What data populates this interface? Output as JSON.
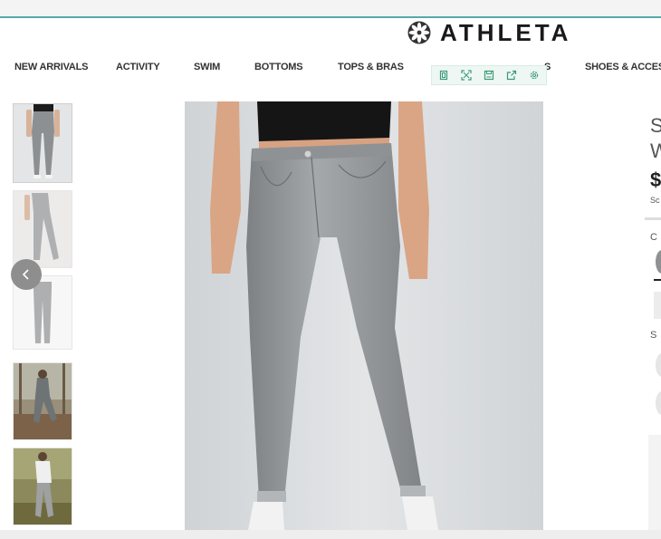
{
  "brand": {
    "name": "ATHLETA",
    "logo_icon": "athleta-logo-icon",
    "accent_color": "#5aa8a8"
  },
  "nav": {
    "items": [
      {
        "label": "NEW ARRIVALS"
      },
      {
        "label": "ACTIVITY"
      },
      {
        "label": "SWIM"
      },
      {
        "label": "BOTTOMS"
      },
      {
        "label": "TOPS & BRAS"
      },
      {
        "label": "S"
      },
      {
        "label": "SHOES & ACCESS"
      }
    ]
  },
  "toolbar": {
    "icons": [
      "copy-icon",
      "expand-icon",
      "save-icon",
      "share-icon",
      "settings-icon"
    ]
  },
  "gallery": {
    "thumbnails": [
      {
        "name": "thumbnail-front-view"
      },
      {
        "name": "thumbnail-walking-view"
      },
      {
        "name": "thumbnail-flat-view"
      },
      {
        "name": "thumbnail-outdoor-view"
      },
      {
        "name": "thumbnail-outdoor-jacket-view"
      }
    ],
    "prev_icon": "chevron-left-icon",
    "main_image": "product-image-gray-skinny-jeans"
  },
  "product_panel": {
    "title_partial_line1": "S",
    "title_partial_line2": "W",
    "price_partial": "$",
    "sub_partial": "Sc",
    "option_partial_1": "C",
    "option_partial_2": "S"
  }
}
